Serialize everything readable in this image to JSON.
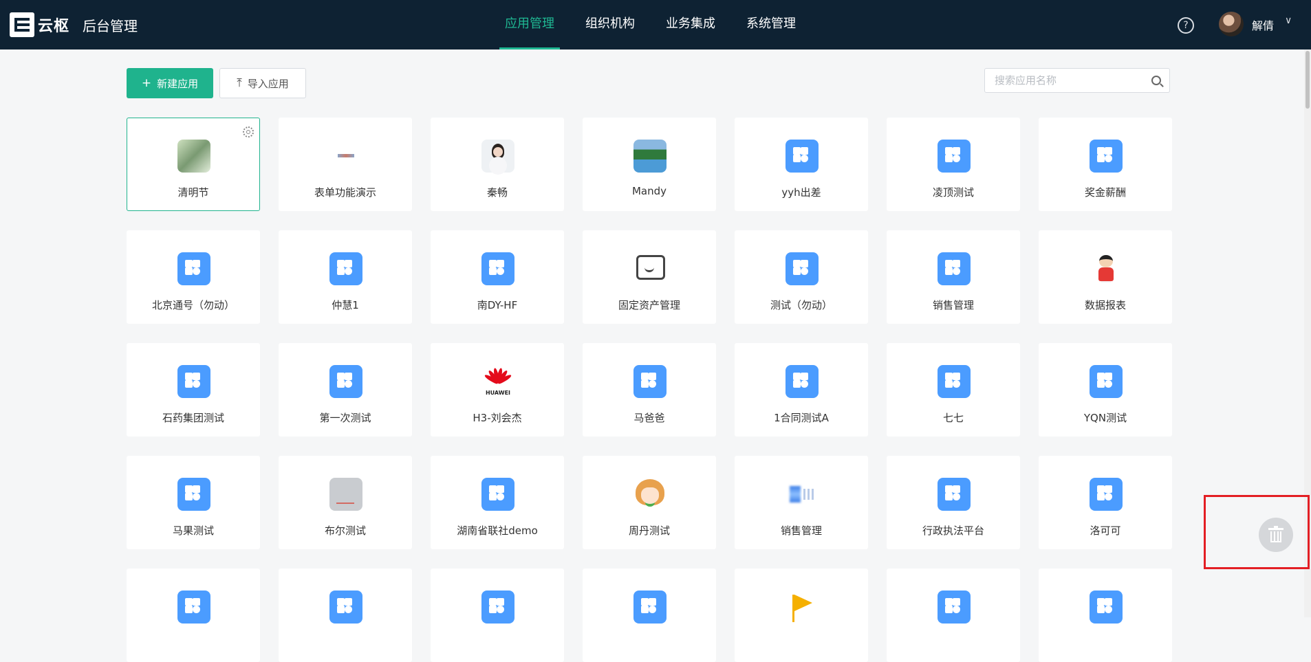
{
  "header": {
    "logo_text": "云枢",
    "title": "后台管理",
    "nav": [
      {
        "label": "应用管理",
        "active": true
      },
      {
        "label": "组织机构",
        "active": false
      },
      {
        "label": "业务集成",
        "active": false
      },
      {
        "label": "系统管理",
        "active": false
      }
    ],
    "help_glyph": "?",
    "user_name": "解倩",
    "user_chevron": "∨"
  },
  "toolbar": {
    "new_app_label": "新建应用",
    "new_app_icon": "plus-icon",
    "import_app_label": "导入应用",
    "import_app_icon": "upload-icon",
    "search_placeholder": "搜索应用名称"
  },
  "apps": [
    {
      "label": "清明节",
      "icon": "photo-green",
      "selected": true
    },
    {
      "label": "表单功能演示",
      "icon": "tiny"
    },
    {
      "label": "秦畅",
      "icon": "portrait"
    },
    {
      "label": "Mandy",
      "icon": "landscape"
    },
    {
      "label": "yyh出差",
      "icon": "grid"
    },
    {
      "label": "凌顶测试",
      "icon": "grid"
    },
    {
      "label": "奖金薪酬",
      "icon": "grid"
    },
    {
      "label": "北京通号（勿动）",
      "icon": "grid"
    },
    {
      "label": "仲慧1",
      "icon": "grid"
    },
    {
      "label": "南DY-HF",
      "icon": "grid"
    },
    {
      "label": "固定资产管理",
      "icon": "chat"
    },
    {
      "label": "测试（勿动）",
      "icon": "grid"
    },
    {
      "label": "销售管理",
      "icon": "grid"
    },
    {
      "label": "数据报表",
      "icon": "cartoon"
    },
    {
      "label": "石药集团测试",
      "icon": "grid"
    },
    {
      "label": "第一次测试",
      "icon": "grid"
    },
    {
      "label": "H3-刘会杰",
      "icon": "huawei",
      "icon_text": "HUAWEI"
    },
    {
      "label": "马爸爸",
      "icon": "grid"
    },
    {
      "label": "1合同测试A",
      "icon": "grid"
    },
    {
      "label": "七七",
      "icon": "grid"
    },
    {
      "label": "YQN测试",
      "icon": "grid"
    },
    {
      "label": "马果测试",
      "icon": "grid"
    },
    {
      "label": "布尔测试",
      "icon": "gray"
    },
    {
      "label": "湖南省联社demo",
      "icon": "grid"
    },
    {
      "label": "周丹测试",
      "icon": "girl"
    },
    {
      "label": "销售管理",
      "icon": "blur"
    },
    {
      "label": "行政执法平台",
      "icon": "grid"
    },
    {
      "label": "洛可可",
      "icon": "grid"
    },
    {
      "label": "",
      "icon": "grid"
    },
    {
      "label": "",
      "icon": "grid"
    },
    {
      "label": "",
      "icon": "grid"
    },
    {
      "label": "",
      "icon": "grid"
    },
    {
      "label": "",
      "icon": "flag"
    },
    {
      "label": "",
      "icon": "grid"
    },
    {
      "label": "",
      "icon": "grid"
    }
  ],
  "trash": {
    "icon": "trash-icon"
  },
  "colors": {
    "header_bg": "#0e2233",
    "accent": "#1fb38d",
    "app_icon_blue": "#4b9cff",
    "highlight_frame": "#e31e24"
  }
}
